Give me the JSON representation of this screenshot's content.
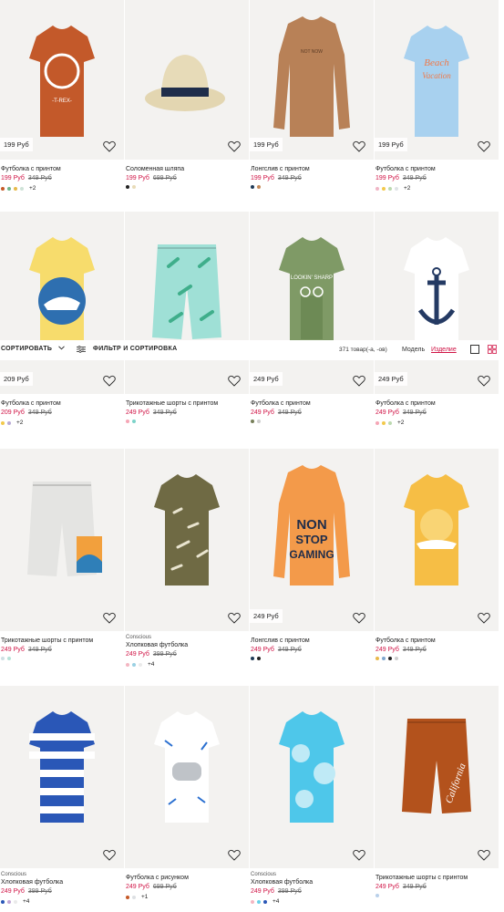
{
  "toolbar": {
    "sort_label": "СОРТИРОВАТЬ",
    "filter_label": "ФИЛЬТР И СОРТИРОВКА",
    "count": "371 товар(-а, -ов)",
    "model_label": "Модель",
    "product_label": "Изделие"
  },
  "products": [
    {
      "title": "Футболка с принтом",
      "tag": "199 Руб",
      "price": "199 Руб",
      "old": "349 Руб",
      "brand": "",
      "colors": [
        "#c55a28",
        "#6fb58a",
        "#e6b94a",
        "#cfe3d8"
      ],
      "more": "+2",
      "art": "TDinos"
    },
    {
      "title": "Соломенная шляпа",
      "tag": "",
      "price": "199 Руб",
      "old": "699 Руб",
      "brand": "",
      "colors": [
        "#222222",
        "#e9dcb8"
      ],
      "more": "",
      "art": "Hat"
    },
    {
      "title": "Лонгслив с принтом",
      "tag": "199 Руб",
      "price": "199 Руб",
      "old": "349 Руб",
      "brand": "",
      "colors": [
        "#1f3a57",
        "#c58a59"
      ],
      "more": "",
      "art": "Longbrown"
    },
    {
      "title": "Футболка с принтом",
      "tag": "199 Руб",
      "price": "199 Руб",
      "old": "349 Руб",
      "brand": "",
      "colors": [
        "#f0b6c6",
        "#f2c94c",
        "#bcd9b0",
        "#dfe3e6"
      ],
      "more": "+2",
      "art": "TBeach"
    },
    {
      "title": "Футболка с принтом",
      "tag": "209 Руб",
      "price": "209 Руб",
      "old": "349 Руб",
      "brand": "",
      "colors": [
        "#f2c94c",
        "#b8a9d6"
      ],
      "more": "+2",
      "art": "TYellowWhale"
    },
    {
      "title": "Трикотажные шорты с принтом",
      "tag": "",
      "price": "249 Руб",
      "old": "349 Руб",
      "brand": "",
      "colors": [
        "#f6a6b6",
        "#7cd3c9"
      ],
      "more": "",
      "art": "ShortsPalm"
    },
    {
      "title": "Футболка с принтом",
      "tag": "249 Руб",
      "price": "249 Руб",
      "old": "349 Руб",
      "brand": "",
      "colors": [
        "#777f5a",
        "#cfcfcf"
      ],
      "more": "",
      "art": "TCactus"
    },
    {
      "title": "Футболка с принтом",
      "tag": "249 Руб",
      "price": "249 Руб",
      "old": "349 Руб",
      "brand": "",
      "colors": [
        "#f6a6b6",
        "#f2c94c",
        "#bcd9b0"
      ],
      "more": "+2",
      "art": "TAnchor"
    },
    {
      "title": "Трикотажные шорты с принтом",
      "tag": "",
      "price": "249 Руб",
      "old": "349 Руб",
      "brand": "",
      "colors": [
        "#cfe0e4",
        "#b6e3d8"
      ],
      "more": "",
      "art": "ShortsGrey"
    },
    {
      "title": "Хлопковая футболка",
      "tag": "",
      "price": "249 Руб",
      "old": "399 Руб",
      "brand": "Conscious",
      "colors": [
        "#f4b6c2",
        "#9ad1e3",
        "#eaeaea"
      ],
      "more": "+4",
      "art": "TDinoKhaki"
    },
    {
      "title": "Лонгслив с принтом",
      "tag": "249 Руб",
      "price": "249 Руб",
      "old": "349 Руб",
      "brand": "",
      "colors": [
        "#1f3a57",
        "#222222"
      ],
      "more": "",
      "art": "LongOrange"
    },
    {
      "title": "Футболка с принтом",
      "tag": "",
      "price": "249 Руб",
      "old": "349 Руб",
      "brand": "",
      "colors": [
        "#e9b84a",
        "#7fa7cf",
        "#222222",
        "#cfcfcf"
      ],
      "more": "",
      "art": "TSun"
    },
    {
      "title": "Хлопковая футболка",
      "tag": "",
      "price": "249 Руб",
      "old": "399 Руб",
      "brand": "Conscious",
      "colors": [
        "#2a57b7",
        "#c2a6d6",
        "#eaeaea"
      ],
      "more": "+4",
      "art": "TStripes"
    },
    {
      "title": "Футболка с рисунком",
      "tag": "",
      "price": "249 Руб",
      "old": "699 Руб",
      "brand": "",
      "colors": [
        "#c55a28",
        "#dde0e3"
      ],
      "more": "+1",
      "art": "TGame"
    },
    {
      "title": "Хлопковая футболка",
      "tag": "",
      "price": "249 Руб",
      "old": "399 Руб",
      "brand": "Conscious",
      "colors": [
        "#f4b6c2",
        "#6ad0e8",
        "#2a57b7"
      ],
      "more": "+4",
      "art": "TTieDye"
    },
    {
      "title": "Трикотажные шорты с принтом",
      "tag": "",
      "price": "249 Руб",
      "old": "349 Руб",
      "brand": "",
      "colors": [
        "#b9d0ea"
      ],
      "more": "",
      "art": "ShortsRust"
    }
  ]
}
